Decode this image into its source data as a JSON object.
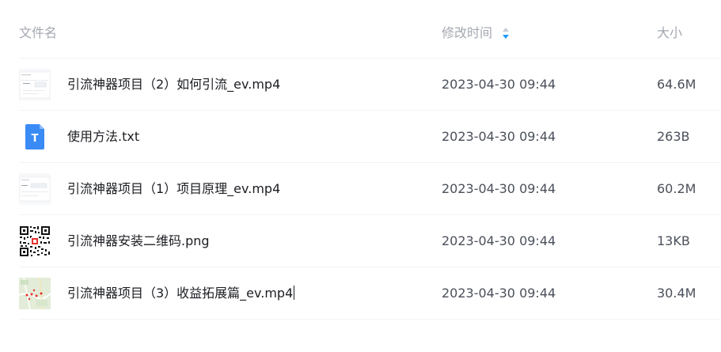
{
  "columns": {
    "name": "文件名",
    "modified": "修改时间",
    "size": "大小"
  },
  "sort": {
    "column": "modified",
    "icon": "sort-icon",
    "active_color": "#1e9bff",
    "inactive_color": "#c8ccd4"
  },
  "files": [
    {
      "name": "引流神器项目（2）如何引流_ev.mp4",
      "modified": "2023-04-30 09:44",
      "size": "64.6M",
      "type": "video"
    },
    {
      "name": "使用方法.txt",
      "modified": "2023-04-30 09:44",
      "size": "263B",
      "type": "text",
      "type_icon_label": "T"
    },
    {
      "name": "引流神器项目（1）项目原理_ev.mp4",
      "modified": "2023-04-30 09:44",
      "size": "60.2M",
      "type": "video"
    },
    {
      "name": "引流神器安装二维码.png",
      "modified": "2023-04-30 09:44",
      "size": "13KB",
      "type": "image-qr"
    },
    {
      "name": "引流神器项目（3）收益拓展篇_ev.mp4",
      "modified": "2023-04-30 09:44",
      "size": "30.4M",
      "type": "video-map"
    }
  ],
  "colors": {
    "header_text": "#a3a7b0",
    "name_text": "#1b1d22",
    "meta_text": "#4a4f5a",
    "divider": "#f2f3f5",
    "txt_icon": "#3a8bf5"
  }
}
